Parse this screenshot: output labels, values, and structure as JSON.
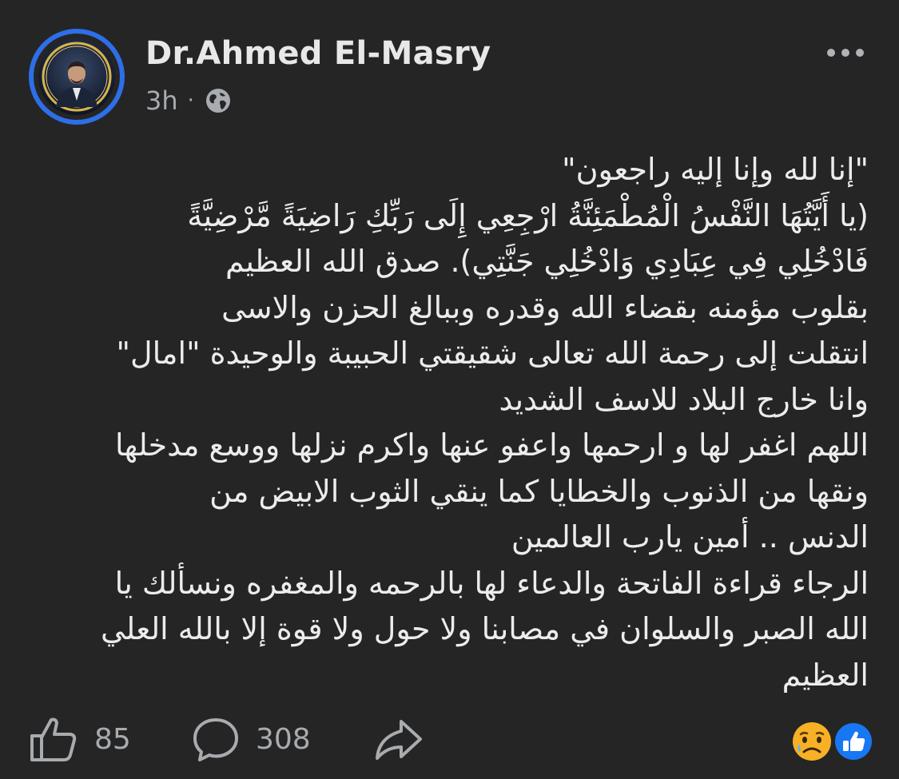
{
  "author": {
    "name": "Dr.Ahmed El-Masry"
  },
  "post": {
    "time": "3h",
    "separator": "·",
    "audience_icon": "globe-icon",
    "more_icon": "more-options-icon",
    "lines": [
      "\"إنا لله وإنا إليه راجعون\"",
      "(يا أَيَّتُهَا النَّفْسُ الْمُطْمَئِنَّةُ ارْجِعِي إِلَى رَبِّكِ رَاضِيَةً مَّرْضِيَّةً",
      "فَادْخُلِي فِي عِبَادِي وَادْخُلِي جَنَّتِي).  صدق الله العظيم",
      "بقلوب مؤمنه بقضاء الله وقدره وببالغ الحزن والاسى",
      " انتقلت إلى رحمة الله تعالى شقيقتي الحبيبة والوحيدة \"امال\"",
      "وانا خارج  البلاد للاسف الشديد",
      "اللهم اغفر لها و ارحمها واعفو عنها واكرم نزلها ووسع مدخلها",
      "ونقها من الذنوب والخطايا كما ينقي الثوب الابيض من",
      "الدنس .. أمين يارب العالمين",
      "الرجاء قراءة الفاتحة والدعاء لها بالرحمه والمغفره ونسألك يا",
      "الله الصبر والسلوان في مصابنا ولا حول ولا قوة إلا بالله العلي",
      "العظيم"
    ]
  },
  "actions": {
    "like_count": "85",
    "comment_count": "308",
    "like_icon": "thumbs-up-icon",
    "comment_icon": "comment-bubble-icon",
    "share_icon": "share-arrow-icon"
  },
  "reactions": {
    "icons": [
      "sad-face-icon",
      "like-reaction-icon"
    ]
  },
  "colors": {
    "background": "#252525",
    "avatar_ring": "#2d6fe8",
    "reaction_like": "#1877f2",
    "reaction_sad": "#f7b125",
    "muted_text": "#a8abaf"
  }
}
